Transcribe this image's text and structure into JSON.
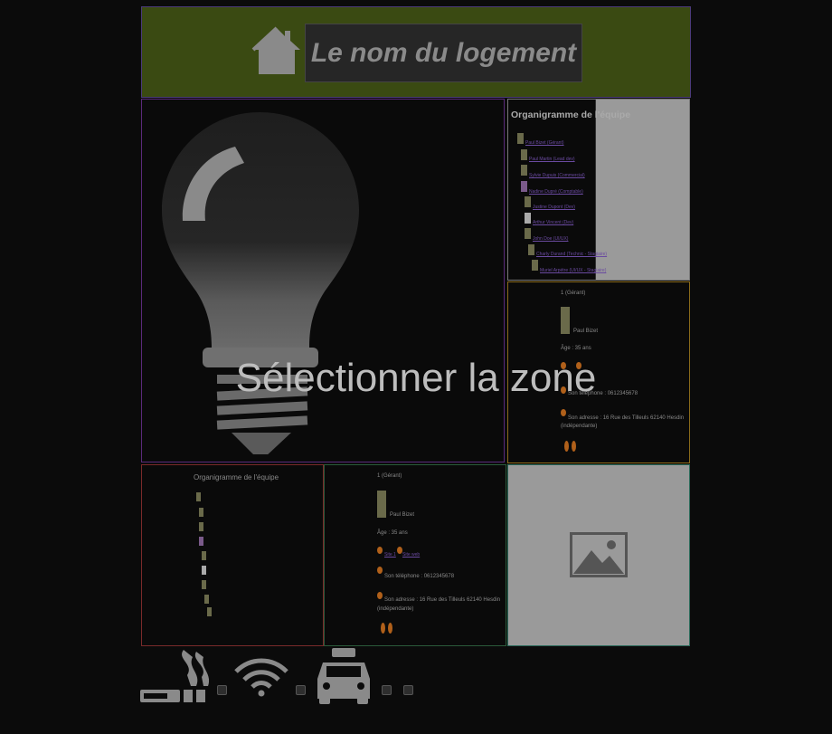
{
  "header": {
    "title": "Le nom du logement"
  },
  "main": {
    "select_zone_label": "Sélectionner la zone"
  },
  "org_panel": {
    "title": "Organigramme de l'équipe",
    "members": [
      "Paul Bizet (Gérant)",
      "Paul Martin (Lead dev)",
      "Sylvie Dupuis (Commercial)",
      "Nadine Dupré (Comptable)",
      "Justine Dupont (Dev)",
      "Arthur Vincent (Dev)",
      "John Doe (UI/UX)",
      "Charly Durand (Technic - Stagiaire)",
      "Muriel Arpétre (UI/UX - Stagiaire)"
    ]
  },
  "org_panel_small": {
    "title": "Organigramme de l'équipe"
  },
  "detail_panel": {
    "header": "1 (Gérant)",
    "name": "Paul Bizet",
    "age": "Âge : 35 ans",
    "links": [
      "Site 1",
      "Site web"
    ],
    "phone": "Son téléphone : 0612345678",
    "address": "Son adresse : 16 Rue des Tilleuls 62140 Hesdin",
    "address_extra": "(indépendante)"
  },
  "colors": {
    "header_bg": "#3a4a12",
    "page_bg": "#0b0b0b",
    "accent_orange": "#b0601a"
  },
  "footer": {
    "icons": [
      "smoking-icon",
      "wifi-icon",
      "taxi-icon"
    ]
  }
}
